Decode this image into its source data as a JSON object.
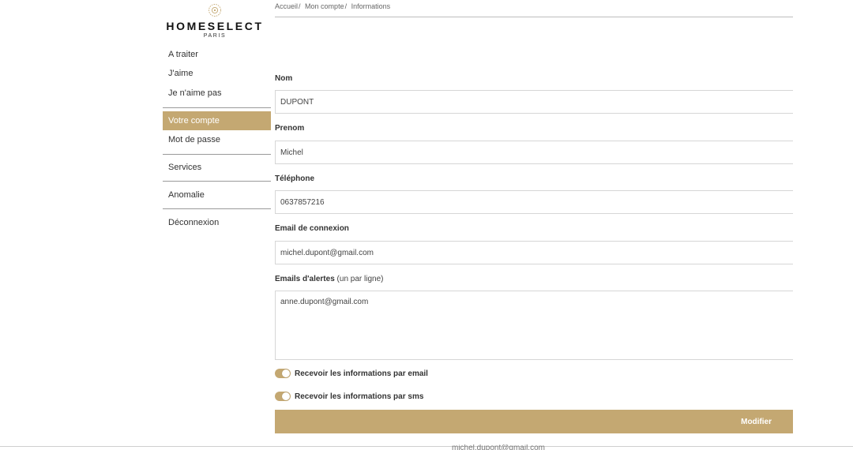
{
  "brand": {
    "name": "HOMESELECT",
    "city": "PARIS",
    "emblem_icon": "lotus-emblem-icon",
    "accent_color": "#c4a872"
  },
  "sidebar": {
    "items": [
      {
        "label": "A traiter"
      },
      {
        "label": "J'aime"
      },
      {
        "label": "Je n'aime pas"
      },
      {
        "label": "Votre compte",
        "active": true
      },
      {
        "label": "Mot de passe"
      },
      {
        "label": "Services"
      },
      {
        "label": "Anomalie"
      },
      {
        "label": "Déconnexion"
      }
    ]
  },
  "breadcrumb": {
    "items": [
      "Accueil",
      "Mon compte",
      "Informations"
    ],
    "separator": "/"
  },
  "form": {
    "nom": {
      "label": "Nom",
      "value": "DUPONT"
    },
    "prenom": {
      "label": "Prenom",
      "value": "Michel"
    },
    "telephone": {
      "label": "Téléphone",
      "value": "0637857216"
    },
    "email_connexion": {
      "label": "Email de connexion",
      "value": "michel.dupont@gmail.com"
    },
    "emails_alertes": {
      "label": "Emails d'alertes",
      "hint": "(un par ligne)",
      "value": "anne.dupont@gmail.com"
    },
    "toggle_email": {
      "label": "Recevoir les informations par email",
      "on": true
    },
    "toggle_sms": {
      "label": "Recevoir les informations par sms",
      "on": true
    },
    "submit_label": "Modifier"
  },
  "footer": {
    "partial_text": "michel.dupont@gmail.com"
  }
}
